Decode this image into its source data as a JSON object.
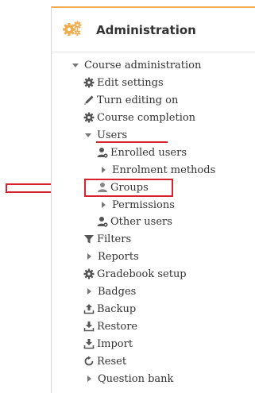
{
  "panel": {
    "title": "Administration",
    "title_icon": "gears-icon",
    "accent_color": "#f0ad4e"
  },
  "annotations": {
    "color": "#d6232f",
    "arrow_icon": "arrow-right-icon"
  },
  "tree": {
    "course_administration": "Course administration",
    "edit_settings": "Edit settings",
    "turn_editing_on": "Turn editing on",
    "course_completion": "Course completion",
    "users": "Users",
    "enrolled_users": "Enrolled users",
    "enrolment_methods": "Enrolment methods",
    "groups": "Groups",
    "permissions": "Permissions",
    "other_users": "Other users",
    "filters": "Filters",
    "reports": "Reports",
    "gradebook_setup": "Gradebook setup",
    "badges": "Badges",
    "backup": "Backup",
    "restore": "Restore",
    "import": "Import",
    "reset": "Reset",
    "question_bank": "Question bank"
  }
}
